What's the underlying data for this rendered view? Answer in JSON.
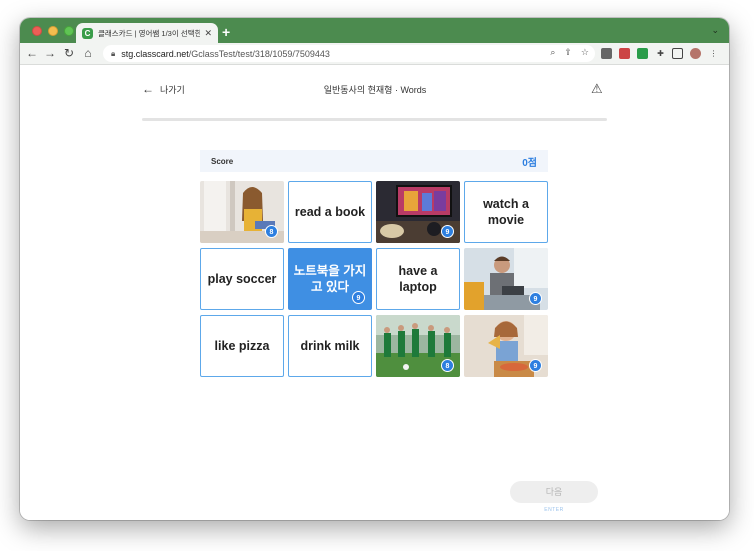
{
  "browser": {
    "tab_title": "클래스카드 | 영어쌤 1/3이 선택한 스",
    "tab_favicon": "C",
    "new_tab_label": "+",
    "url_domain": "stg.classcard.net",
    "url_path": "/GclassTest/test/318/1059/7509443"
  },
  "page": {
    "back_label": "나가기",
    "title": "일반동사의 현재형 · Words",
    "score_label": "Score",
    "score_value": "0점",
    "next_label": "다음",
    "enter_hint": "ENTER"
  },
  "cards": [
    {
      "type": "image",
      "image": "girl-reading-book",
      "badge": "8"
    },
    {
      "type": "text",
      "text": "read a book"
    },
    {
      "type": "image",
      "image": "watching-tv",
      "badge": "9"
    },
    {
      "type": "text",
      "text": "watch a movie"
    },
    {
      "type": "text",
      "text": "play soccer"
    },
    {
      "type": "text",
      "text": "노트북을 가지고 있다",
      "badge": "9",
      "selected": true
    },
    {
      "type": "text",
      "text": "have a laptop"
    },
    {
      "type": "image",
      "image": "boy-with-laptop",
      "badge": "9"
    },
    {
      "type": "text",
      "text": "like pizza"
    },
    {
      "type": "text",
      "text": "drink milk"
    },
    {
      "type": "image",
      "image": "kids-playing-soccer",
      "badge": "8"
    },
    {
      "type": "image",
      "image": "girl-eating-pizza",
      "badge": "9"
    }
  ],
  "colors": {
    "accent": "#2d7fe0",
    "selected_card": "#3f8fe3",
    "browser_frame": "#4c8b4f"
  }
}
